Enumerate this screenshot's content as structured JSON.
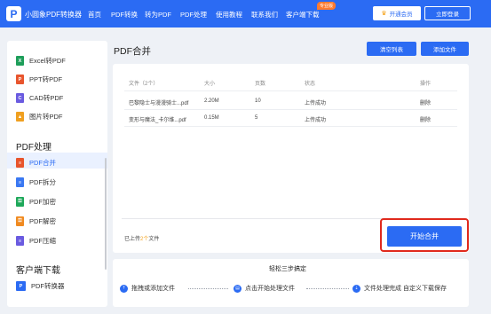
{
  "header": {
    "logo_glyph": "P",
    "logo_text": "小圆象PDF转换器",
    "nav": [
      "首页",
      "PDF转换",
      "转为PDF",
      "PDF处理",
      "使用教程",
      "联系我们",
      "客户端下载"
    ],
    "nav_badge": "专业版",
    "vip_label": "开通会员",
    "login_label": "立即登录"
  },
  "sidebar": {
    "convert_items": [
      {
        "label": "Excel转PDF",
        "icon": "excel-icon",
        "color": "#1e9e5a",
        "glyph": "X"
      },
      {
        "label": "PPT转PDF",
        "icon": "ppt-icon",
        "color": "#e8552d",
        "glyph": "P"
      },
      {
        "label": "CAD转PDF",
        "icon": "cad-icon",
        "color": "#6a5be0",
        "glyph": "C"
      },
      {
        "label": "图片转PDF",
        "icon": "image-icon",
        "color": "#f0a020",
        "glyph": "▲"
      }
    ],
    "section_pdf": "PDF处理",
    "process_items": [
      {
        "label": "PDF合并",
        "icon": "merge-icon",
        "color": "#e8552d",
        "glyph": "≡"
      },
      {
        "label": "PDF拆分",
        "icon": "split-icon",
        "color": "#3a78f2",
        "glyph": "≡"
      },
      {
        "label": "PDF加密",
        "icon": "encrypt-icon",
        "color": "#1ea85a",
        "glyph": "⚿"
      },
      {
        "label": "PDF解密",
        "icon": "decrypt-icon",
        "color": "#f08a20",
        "glyph": "⚿"
      },
      {
        "label": "PDF压缩",
        "icon": "compress-icon",
        "color": "#6a5be0",
        "glyph": "≡"
      }
    ],
    "section_client": "客户端下载",
    "client_item": {
      "label": "PDF转换器",
      "icon": "app-icon",
      "color": "#2b6bf3",
      "glyph": "P"
    }
  },
  "main": {
    "title": "PDF合并",
    "clear_label": "清空列表",
    "add_label": "添加文件",
    "table_headers": [
      "文件（2个）",
      "大小",
      "页数",
      "状态",
      "操作"
    ],
    "rows": [
      {
        "name": "巴黎隐士与漫漫骑士...pdf",
        "size": "2.20M",
        "pages": "10",
        "status": "上传成功",
        "action": "删除"
      },
      {
        "name": "变形与魔法_卡尔维...pdf",
        "size": "0.15M",
        "pages": "5",
        "status": "上传成功",
        "action": "删除"
      }
    ],
    "uploaded_prefix": "已上传",
    "uploaded_count": "2个",
    "uploaded_suffix": "文件",
    "start_label": "开始合并"
  },
  "steps": {
    "title": "轻松三步搞定",
    "items": [
      {
        "label": "拖拽或添加文件",
        "icon": "upload-icon",
        "glyph": "⇡"
      },
      {
        "label": "点击开始处理文件",
        "icon": "file-icon",
        "glyph": "▤"
      },
      {
        "label": "文件处理完成 自定义下载保存",
        "icon": "download-icon",
        "glyph": "⇣"
      }
    ]
  }
}
